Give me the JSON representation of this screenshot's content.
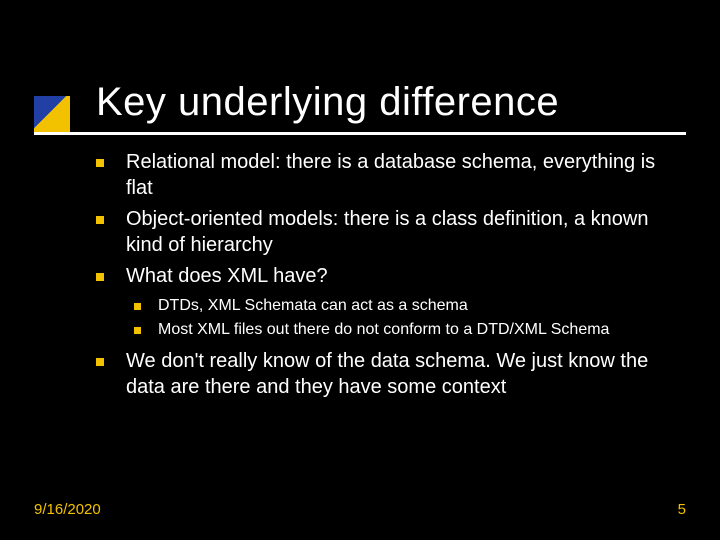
{
  "title": "Key underlying difference",
  "bullets": {
    "b1": "Relational model: there is a database schema, everything is flat",
    "b2": "Object-oriented models: there is a class definition, a known kind of hierarchy",
    "b3": "What does XML have?",
    "b3_1": "DTDs, XML Schemata can act as a schema",
    "b3_2": "Most XML files out there do not conform to a DTD/XML Schema",
    "b4": "We don't really know of the data schema. We just know the data are there and they have some context"
  },
  "footer": {
    "date": "9/16/2020",
    "page": "5"
  }
}
